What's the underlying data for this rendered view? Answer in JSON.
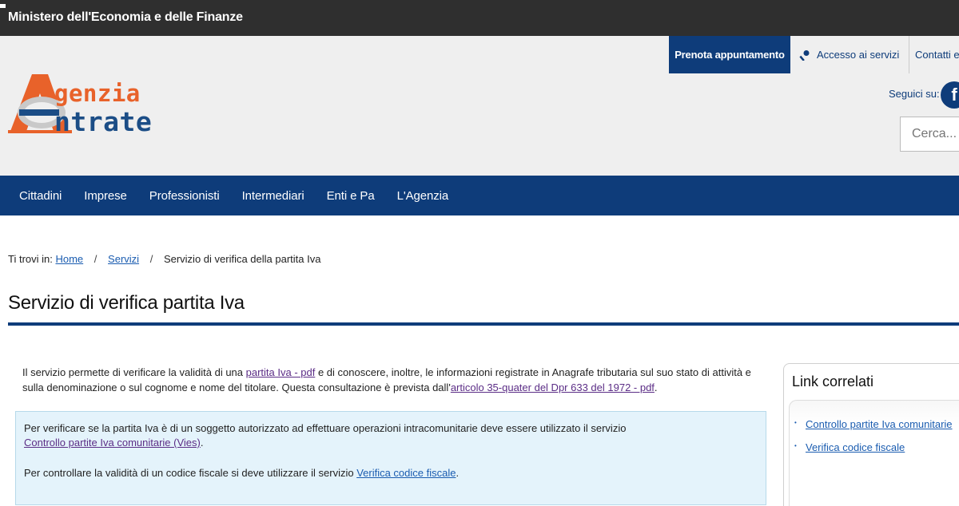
{
  "topbar": {
    "ministry": "Ministero dell'Economia e delle Finanze"
  },
  "header": {
    "logo": {
      "word1": "genzia",
      "word2": "ntrate"
    },
    "prenota": "Prenota appuntamento",
    "accesso": "Accesso ai servizi",
    "contatti": "Contatti e",
    "seguici": "Seguici su:",
    "search_placeholder": "Cerca..."
  },
  "nav": {
    "items": [
      "Cittadini",
      "Imprese",
      "Professionisti",
      "Intermediari",
      "Enti e Pa",
      "L'Agenzia"
    ]
  },
  "breadcrumb": {
    "prefix": "Ti trovi in:",
    "home": "Home",
    "servizi": "Servizi",
    "current": "Servizio di verifica della partita Iva"
  },
  "page": {
    "title": "Servizio di verifica partita Iva"
  },
  "intro": {
    "t1": "Il servizio permette di verificare la validità di una ",
    "link1": "partita Iva - pdf",
    "t2": " e di conoscere, inoltre, le informazioni registrate in Anagrafe tributaria sul suo stato di attività e sulla denominazione o sul cognome e nome del titolare. Questa consultazione è prevista dall'",
    "link2": "articolo 35-quater del Dpr 633 del 1972 - pdf",
    "t3": "."
  },
  "infobox": {
    "p1_text": "Per verificare se la partita Iva è di un soggetto autorizzato ad effettuare operazioni intracomunitarie deve essere utilizzato il servizio",
    "p1_link": "Controllo partite Iva comunitarie (Vies)",
    "p1_end": ".",
    "p2_text": "Per controllare la validità di un codice fiscale si deve utilizzare il servizio ",
    "p2_link": "Verifica codice fiscale",
    "p2_end": "."
  },
  "related": {
    "title": "Link correlati",
    "items": [
      "Controllo partite Iva comunitarie",
      "Verifica codice fiscale"
    ]
  },
  "colors": {
    "brand_blue": "#0e3c7a",
    "brand_orange": "#e8622a",
    "info_bg": "#e4f3fb"
  }
}
